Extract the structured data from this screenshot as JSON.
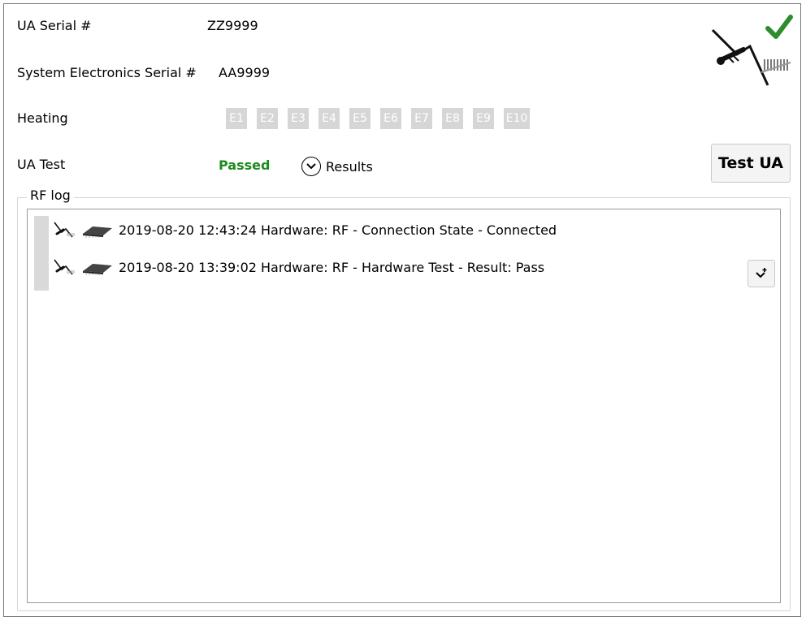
{
  "fields": {
    "ua_serial_label": "UA Serial #",
    "ua_serial_value": "ZZ9999",
    "sys_serial_label": "System Electronics Serial #",
    "sys_serial_value": "AA9999",
    "heating_label": "Heating",
    "ua_test_label": "UA Test",
    "ua_test_status": "Passed"
  },
  "heating_elements": [
    "E1",
    "E2",
    "E3",
    "E4",
    "E5",
    "E6",
    "E7",
    "E8",
    "E9",
    "E10"
  ],
  "actions": {
    "results_label": "Results",
    "test_ua_label": "Test UA"
  },
  "rf_log": {
    "title": "RF log",
    "entries": [
      "2019-08-20 12:43:24 Hardware: RF - Connection State - Connected",
      "2019-08-20 13:39:02 Hardware: RF - Hardware Test - Result: Pass"
    ]
  },
  "colors": {
    "passed": "#1d8a1d",
    "check": "#2e8b2e",
    "pill_bg": "#d6d6d6"
  },
  "icons": {
    "status": "checkmark-icon",
    "device": "ultrasound-probe-icon",
    "chip": "microchip-icon",
    "toggle": "chevron-down-icon",
    "scroll": "scroll-to-bottom-icon"
  }
}
